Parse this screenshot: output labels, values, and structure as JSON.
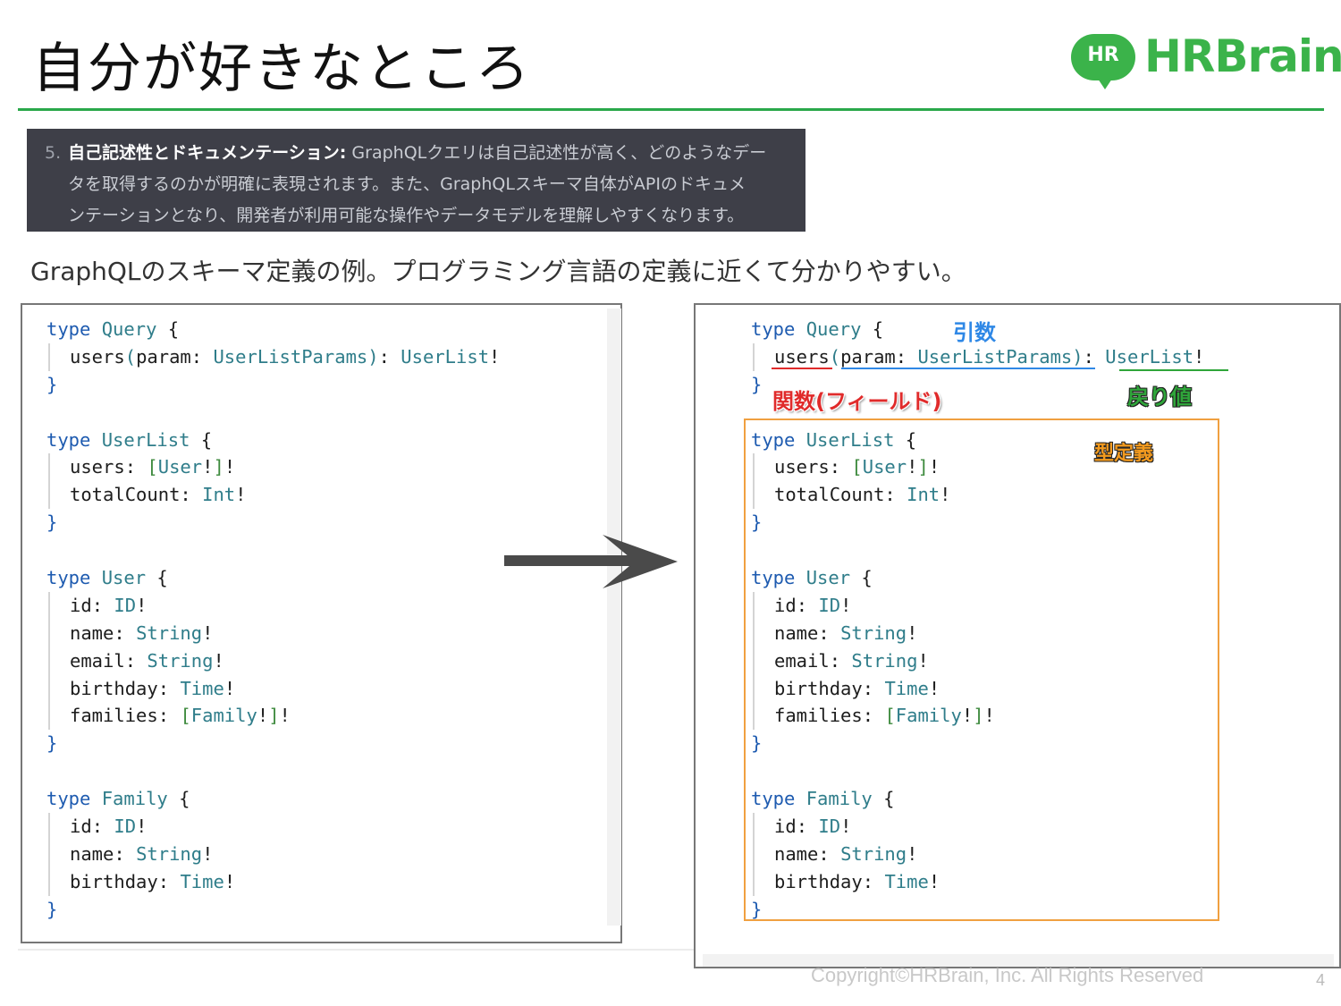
{
  "slide": {
    "title": "自分が好きなところ",
    "logo": {
      "badge": "HR",
      "text": "HRBrain"
    },
    "accent_color": "#2aa84a",
    "quote": {
      "number": "5.",
      "heading": "自己記述性とドキュメンテーション:",
      "line1_rest": " GraphQLクエリは自己記述性が高く、どのようなデー",
      "line2": "タを取得するのかが明確に表現されます。また、GraphQLスキーマ自体がAPIのドキュメ",
      "line3": "ンテーションとなり、開発者が利用可能な操作やデータモデルを理解しやすくなります。"
    },
    "caption": "GraphQLのスキーマ定義の例。プログラミング言語の定義に近くて分かりやすい。",
    "annotations": {
      "argument": "引数",
      "function_field": "関数(フィールド)",
      "return_value": "戻り値",
      "type_definition": "型定義"
    },
    "footer": {
      "copyright": "Copyright©HRBrain, Inc. All Rights Reserved",
      "page_number": "4"
    }
  },
  "schema": {
    "keyword": "type",
    "types": [
      {
        "name": "Query",
        "fields": [
          {
            "name": "users",
            "args": "param: UserListParams",
            "type": "UserList",
            "list": false
          }
        ]
      },
      {
        "name": "UserList",
        "fields": [
          {
            "name": "users",
            "type": "User",
            "list": true
          },
          {
            "name": "totalCount",
            "type": "Int",
            "list": false
          }
        ]
      },
      {
        "name": "User",
        "fields": [
          {
            "name": "id",
            "type": "ID",
            "list": false
          },
          {
            "name": "name",
            "type": "String",
            "list": false
          },
          {
            "name": "email",
            "type": "String",
            "list": false
          },
          {
            "name": "birthday",
            "type": "Time",
            "list": false
          },
          {
            "name": "families",
            "type": "Family",
            "list": true
          }
        ]
      },
      {
        "name": "Family",
        "fields": [
          {
            "name": "id",
            "type": "ID",
            "list": false
          },
          {
            "name": "name",
            "type": "String",
            "list": false
          },
          {
            "name": "birthday",
            "type": "Time",
            "list": false
          }
        ]
      }
    ]
  }
}
